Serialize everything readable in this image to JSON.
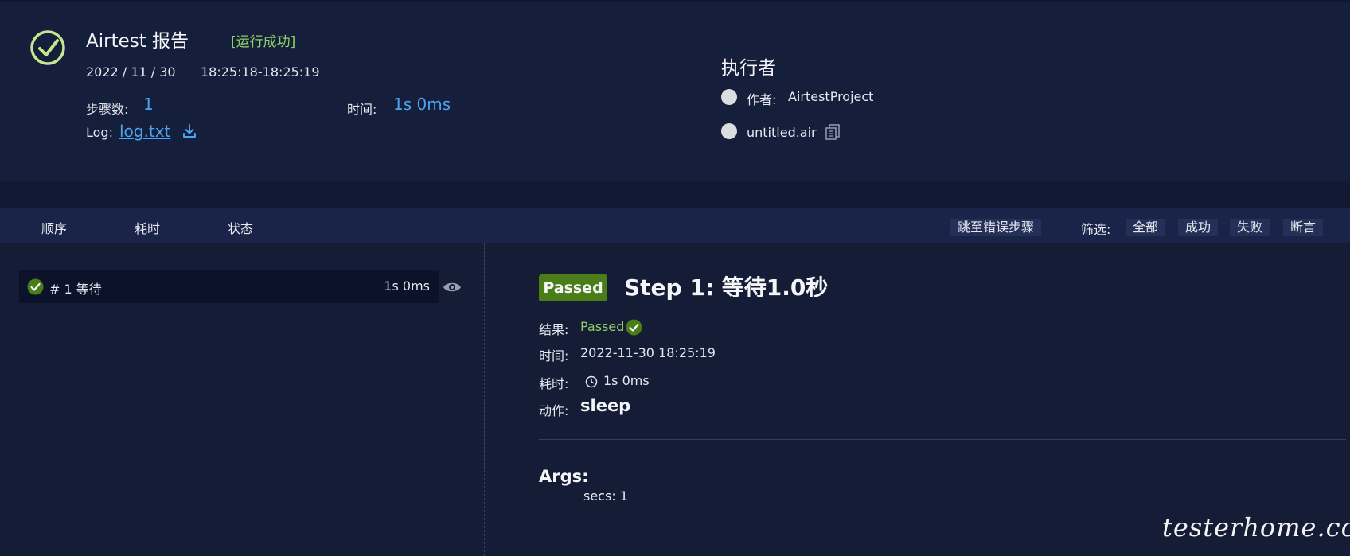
{
  "report": {
    "title": "Airtest 报告",
    "status": "[运行成功]",
    "date": "2022 / 11 / 30",
    "time_range": "18:25:18-18:25:19",
    "steps_label": "步骤数:",
    "steps_value": "1",
    "time_label": "时间:",
    "time_value": "1s 0ms",
    "log_label": "Log:",
    "log_link": "log.txt",
    "icons": {
      "status": "check-circle-icon",
      "download": "download-icon"
    }
  },
  "executor": {
    "title": "执行者",
    "author_label": "作者:",
    "author": "AirtestProject",
    "script": "untitled.air",
    "icons": {
      "copy": "copy-icon"
    }
  },
  "toolbar": {
    "columns": [
      "顺序",
      "耗时",
      "状态"
    ],
    "jump_error": "跳至错误步骤",
    "filter_label": "筛选:",
    "filters": [
      "全部",
      "成功",
      "失败",
      "断言"
    ]
  },
  "steps": [
    {
      "label": "# 1 等待",
      "duration": "1s 0ms",
      "status": "passed"
    }
  ],
  "detail": {
    "badge": "Passed",
    "title": "Step 1: 等待1.0秒",
    "result_label": "结果:",
    "result": "Passed",
    "time_label": "时间:",
    "time": "2022-11-30 18:25:19",
    "duration_label": "耗时:",
    "duration": "1s 0ms",
    "action_label": "动作:",
    "action": "sleep",
    "args_title": "Args:",
    "args": "secs: 1"
  },
  "watermark": "testerhome.com",
  "colors": {
    "background": "#141c36",
    "header": "#151e3a",
    "accent_blue": "#4ca3ee",
    "success_green": "#8fd066",
    "badge_green": "#4a7d17"
  }
}
